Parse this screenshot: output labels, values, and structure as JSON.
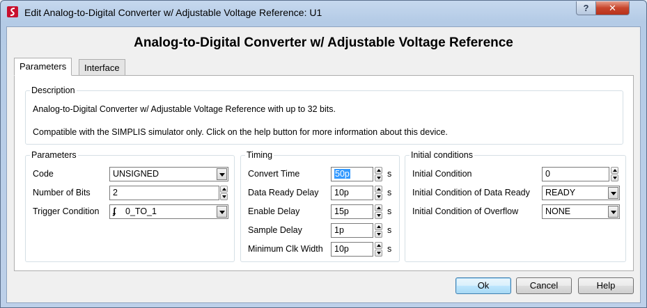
{
  "window": {
    "title": "Edit Analog-to-Digital Converter w/ Adjustable Voltage Reference: U1",
    "help_glyph": "?",
    "close_glyph": "✕",
    "icon": "simplis-app-icon"
  },
  "heading": "Analog-to-Digital Converter w/ Adjustable Voltage Reference",
  "tabs": [
    {
      "label": "Parameters",
      "active": true
    },
    {
      "label": "Interface",
      "active": false
    }
  ],
  "description": {
    "title": "Description",
    "line1": "Analog-to-Digital Converter w/ Adjustable Voltage Reference with up to 32 bits.",
    "line2": "Compatible with the SIMPLIS simulator only. Click on the help button for more information about this device."
  },
  "parameters": {
    "title": "Parameters",
    "code": {
      "label": "Code",
      "value": "UNSIGNED"
    },
    "bits": {
      "label": "Number of Bits",
      "value": "2"
    },
    "trigger": {
      "label": "Trigger Condition",
      "value": "0_TO_1",
      "icon": "rising-edge-icon",
      "glyph": "ʄ"
    }
  },
  "timing": {
    "title": "Timing",
    "rows": [
      {
        "label": "Convert Time",
        "value": "50p",
        "unit": "s",
        "selected": true
      },
      {
        "label": "Data Ready Delay",
        "value": "10p",
        "unit": "s"
      },
      {
        "label": "Enable Delay",
        "value": "15p",
        "unit": "s"
      },
      {
        "label": "Sample Delay",
        "value": "1p",
        "unit": "s"
      },
      {
        "label": "Minimum Clk Width",
        "value": "10p",
        "unit": "s"
      }
    ]
  },
  "initial": {
    "title": "Initial conditions",
    "condition": {
      "label": "Initial Condition",
      "value": "0"
    },
    "data_ready": {
      "label": "Initial Condition of Data Ready",
      "value": "READY"
    },
    "overflow": {
      "label": "Initial Condition of Overflow",
      "value": "NONE"
    }
  },
  "buttons": {
    "ok": "Ok",
    "cancel": "Cancel",
    "help": "Help"
  }
}
